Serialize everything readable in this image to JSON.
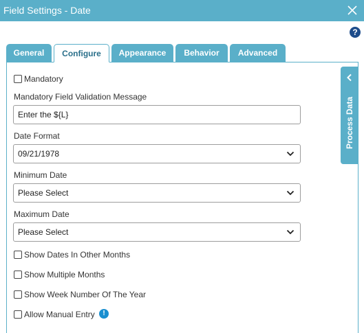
{
  "window": {
    "title": "Field Settings - Date"
  },
  "tabs": [
    {
      "label": "General"
    },
    {
      "label": "Configure"
    },
    {
      "label": "Appearance"
    },
    {
      "label": "Behavior"
    },
    {
      "label": "Advanced"
    }
  ],
  "active_tab": "Configure",
  "mandatory": {
    "label": "Mandatory",
    "checked": false
  },
  "validation_message": {
    "label": "Mandatory Field Validation Message",
    "value": "Enter the ${L}"
  },
  "date_format": {
    "label": "Date Format",
    "value": "09/21/1978"
  },
  "minimum_date": {
    "label": "Minimum Date",
    "value": "Please Select"
  },
  "maximum_date": {
    "label": "Maximum Date",
    "value": "Please Select"
  },
  "options": {
    "show_other_months": {
      "label": "Show Dates In Other Months",
      "checked": false
    },
    "show_multiple_months": {
      "label": "Show Multiple Months",
      "checked": false
    },
    "show_week_number": {
      "label": "Show Week Number Of The Year",
      "checked": false
    },
    "allow_manual_entry": {
      "label": "Allow Manual Entry",
      "checked": false
    }
  },
  "process_data": {
    "label": "Process Data"
  },
  "colors": {
    "accent": "#5aafc9",
    "help": "#1e4d8b",
    "info": "#1a8fd0"
  }
}
